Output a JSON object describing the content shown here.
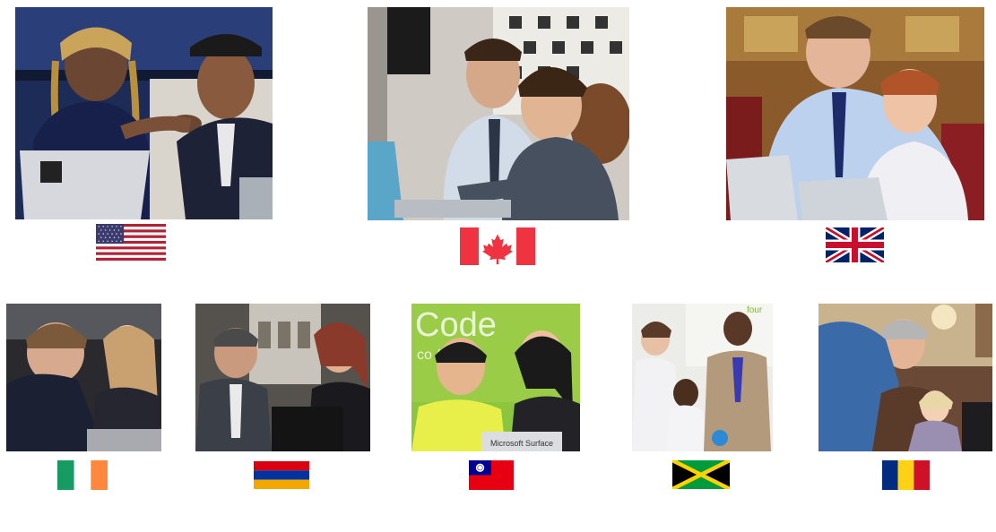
{
  "top_row": [
    {
      "id": "usa",
      "photo_desc": "photo-usa",
      "flag": "united-states-flag"
    },
    {
      "id": "canada",
      "photo_desc": "photo-canada",
      "flag": "canada-flag"
    },
    {
      "id": "uk",
      "photo_desc": "photo-uk",
      "flag": "united-kingdom-flag"
    }
  ],
  "bottom_row": [
    {
      "id": "ireland",
      "photo_desc": "photo-ireland",
      "flag": "ireland-flag"
    },
    {
      "id": "armenia",
      "photo_desc": "photo-armenia",
      "flag": "armenia-flag"
    },
    {
      "id": "taiwan",
      "photo_desc": "photo-taiwan",
      "flag": "taiwan-flag",
      "photo_text": {
        "code": "Code",
        "sub": "co    /mc",
        "badge": "Microsoft Surface"
      }
    },
    {
      "id": "jamaica",
      "photo_desc": "photo-jamaica",
      "flag": "jamaica-flag",
      "photo_text": {
        "corner": "four"
      }
    },
    {
      "id": "romania",
      "photo_desc": "photo-romania",
      "flag": "romania-flag"
    }
  ],
  "colors": {
    "us_red": "#B22234",
    "us_blue": "#3C3B6E",
    "ca_red": "#EF3340",
    "uk_blue": "#012169",
    "uk_red": "#C8102E",
    "ie_green": "#169B62",
    "ie_orange": "#FF883E",
    "am_red": "#D90012",
    "am_blue": "#0033A0",
    "am_orange": "#F2A800",
    "tw_red": "#E60012",
    "tw_blue": "#000095",
    "jm_green": "#009B3A",
    "jm_gold": "#FED100",
    "ro_blue": "#002B7F",
    "ro_yellow": "#FCD116",
    "ro_red": "#CE1126"
  }
}
